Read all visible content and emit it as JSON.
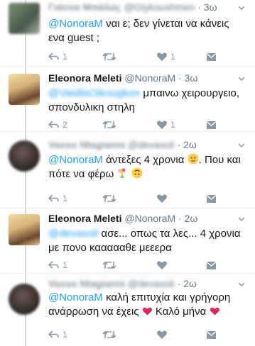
{
  "tweets": [
    {
      "name": "Γιάννα Μπάλας",
      "handle": "@Glykoushmen",
      "time": "3ω",
      "mention": "@NonoraM",
      "text_line1": " ναι ε;  δεν γίνεται να κάνεις",
      "text_line2": "ενα guest ;",
      "reply_count": "1",
      "retweet_count": "",
      "like_count": "1"
    },
    {
      "name": "Eleonora Meleti",
      "handle": "@NonoraM",
      "time": "3ω",
      "mention": "@VasilisOikougkon",
      "text_line1": " μπαινω χειρουργειο,",
      "text_line2": "σπονδυλικη στηλη",
      "reply_count": "2",
      "retweet_count": "",
      "like_count": "1"
    },
    {
      "name": "Vasso Ntagianni",
      "handle": "@devasoli",
      "time": "2ω",
      "mention": "@NonoraM",
      "text_line1": " άντεξες 4 χρονια ",
      "text_line1b": ". Που και",
      "text_line2": "πότε να φέρω ",
      "reply_count": "1",
      "retweet_count": "",
      "like_count": ""
    },
    {
      "name": "Eleonora Meleti",
      "handle": "@NonoraM",
      "time": "2ω",
      "mention": "@devasoli",
      "text_line1": " ασε... οπως τα λες... 4 χρονια",
      "text_line2": "με πονο καααααθε μεεερα",
      "reply_count": "1",
      "retweet_count": "",
      "like_count": ""
    },
    {
      "name": "Vasso Ntagianni",
      "handle": "@devasoli",
      "time": "2ω",
      "mention": "@NonoraM",
      "text_line1": " καλή επιτυχία και γρήγορη",
      "text_line2": "ανάρρωση να έχεις ",
      "text_line2b": " Καλό μήνα ",
      "reply_count": "1",
      "retweet_count": "",
      "like_count": ""
    }
  ],
  "colors": {
    "link": "#1da1f2",
    "icon": "#8899a6",
    "divider": "#e6ecf0",
    "heart": "#e0245e"
  },
  "icons": [
    "reply-icon",
    "retweet-icon",
    "like-icon",
    "dm-icon",
    "chevron-down-icon",
    "neutral-face-emoji",
    "bouquet-emoji",
    "upside-down-face-emoji",
    "red-heart-emoji"
  ]
}
